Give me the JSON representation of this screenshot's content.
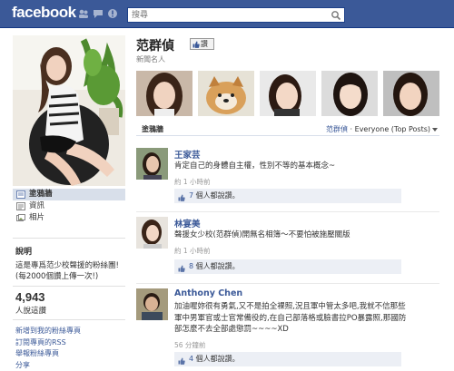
{
  "topbar": {
    "logo": "facebook",
    "search_placeholder": "搜尋",
    "icons": [
      "friends-icon",
      "messages-icon",
      "notifications-icon",
      "search-icon"
    ]
  },
  "left_nav": {
    "items": [
      {
        "label": "塗鴉牆",
        "icon": "wall-icon",
        "active": true
      },
      {
        "label": "資訊",
        "icon": "info-icon",
        "active": false
      },
      {
        "label": "相片",
        "icon": "photos-icon",
        "active": false
      }
    ]
  },
  "about": {
    "heading": "說明",
    "text": "這是專爲范少校聲援的粉絲團! (每2000個讚上傳一次!)"
  },
  "likes": {
    "count": "4,943",
    "label": "人說這讚"
  },
  "links": [
    "新增到我的粉絲專頁",
    "訂閱專頁的RSS",
    "舉報粉絲專頁",
    "分享"
  ],
  "page": {
    "title": "范群偵",
    "like_button": "讚",
    "category": "新聞名人"
  },
  "wall": {
    "title": "塗鴉牆",
    "filter_owner": "范群偵",
    "filter_rest": " · Everyone (Top Posts)"
  },
  "posts": [
    {
      "author": "王家芸",
      "text": "肯定自己的身體自主權，性別不等的基本概念~",
      "time": "約 1 小時前",
      "likes_count": "7",
      "likes_suffix": " 個人都說讚。"
    },
    {
      "author": "林宴美",
      "text": "聲援女少校(范群偵)開無名相簿～不要怕被施壓關版",
      "time": "約 1 小時前",
      "likes_count": "8",
      "likes_suffix": " 個人都說讚。"
    },
    {
      "author": "Anthony Chen",
      "text": "加油喔妳很有勇氣,又不是拍全裸照,況且軍中管太多吧,我就不信那些軍中男軍官或士官常備役的,在自己部落格或臉書拉PO暴露照,那國防部怎麼不去全部處懲罰~~~~XD",
      "time": "56 分鐘前",
      "likes_count": "4",
      "likes_suffix": " 個人都說讚。"
    }
  ],
  "colors": {
    "brand": "#3b5998",
    "link": "#3b5998",
    "like_box": "#eceff5",
    "active_nav": "#d8dfea"
  }
}
